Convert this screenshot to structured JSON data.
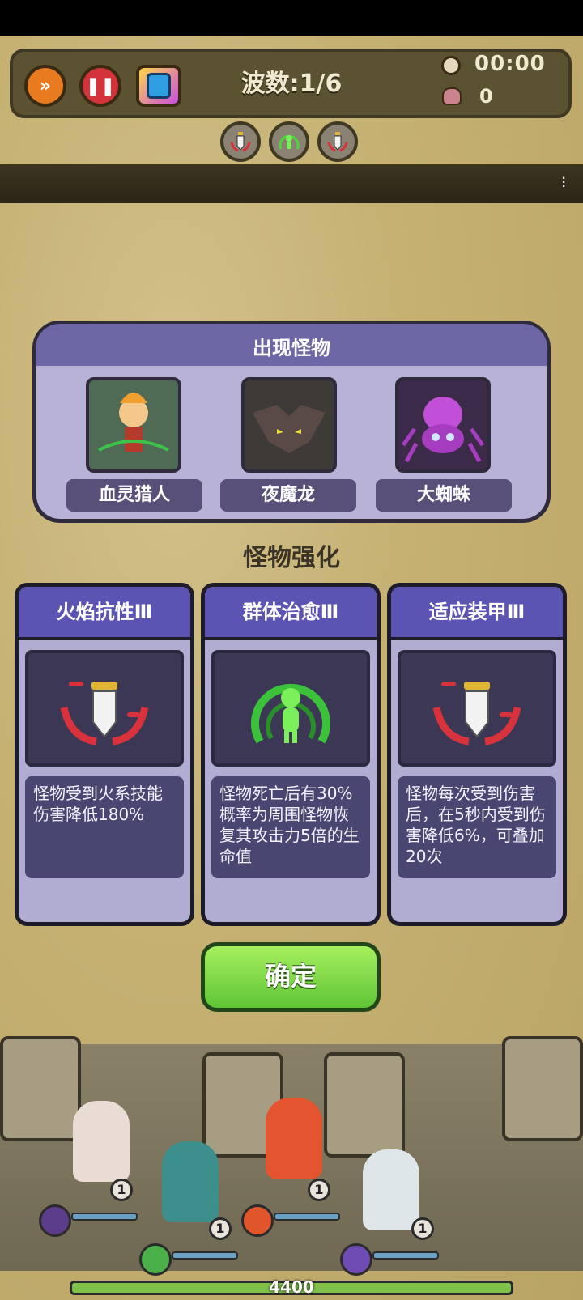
{
  "hud": {
    "wave_label": "波数:1/6",
    "timer": "00:00",
    "kills": "0"
  },
  "monsters_panel": {
    "title": "出现怪物",
    "monsters": [
      {
        "name": "血灵猎人"
      },
      {
        "name": "夜魔龙"
      },
      {
        "name": "大蜘蛛"
      }
    ]
  },
  "section_title": "怪物强化",
  "cards": [
    {
      "title": "火焰抗性Ⅲ",
      "description": "怪物受到火系技能伤害降低180%",
      "icon": "dagger-icon"
    },
    {
      "title": "群体治愈Ⅲ",
      "description": "怪物死亡后有30%概率为周围怪物恢复其攻击力5倍的生命值",
      "icon": "heal-icon"
    },
    {
      "title": "适应装甲Ⅲ",
      "description": "怪物每次受到伤害后，在5秒内受到伤害降低6%，可叠加20次",
      "icon": "dagger-icon"
    }
  ],
  "confirm_label": "确定",
  "heroes": [
    {
      "level": "1"
    },
    {
      "level": "1"
    },
    {
      "level": "1"
    },
    {
      "level": "1"
    }
  ],
  "base_hp": "4400",
  "colors": {
    "accent_purple": "#5b54b3",
    "confirm_green": "#6fd33e",
    "hp_green": "#7fc24a"
  }
}
